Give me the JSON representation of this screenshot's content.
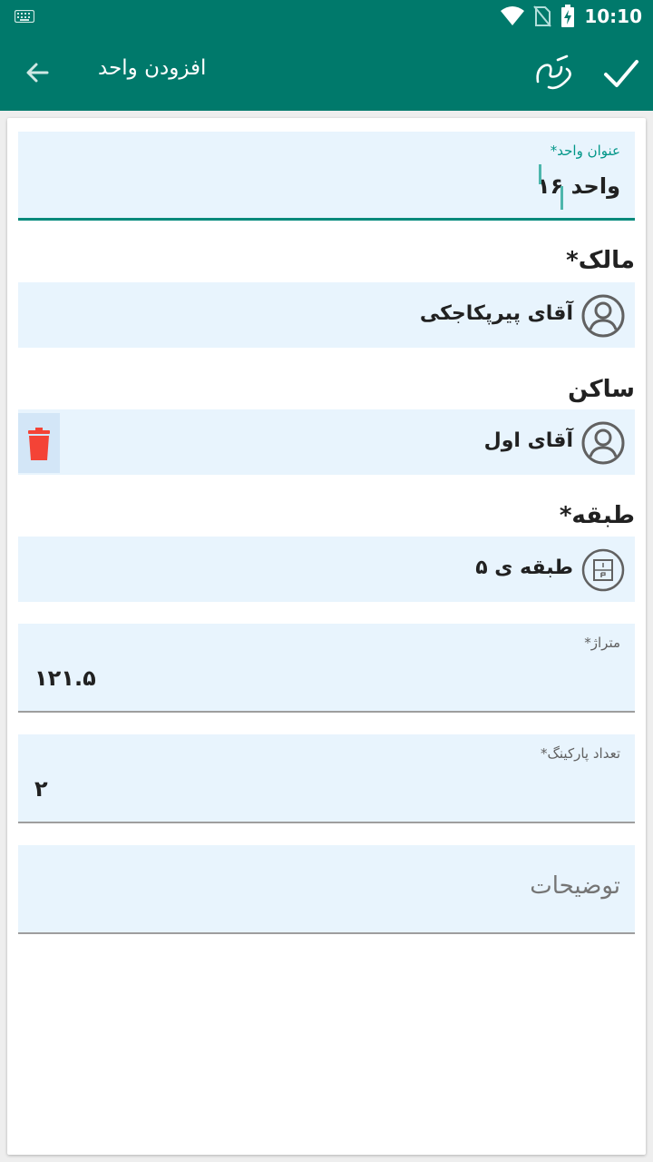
{
  "status": {
    "time": "10:10"
  },
  "toolbar": {
    "title": "افزودن واحد"
  },
  "form": {
    "unit_title": {
      "label": "عنوان واحد*",
      "value": "واحد ۱۶"
    },
    "owner": {
      "label": "مالک*",
      "name": "آقای پیرپکاجکی"
    },
    "resident": {
      "label": "ساکن",
      "name": "آقای اول"
    },
    "floor": {
      "label": "طبقه*",
      "name": "طبقه ی ۵"
    },
    "area": {
      "label": "متراژ*",
      "value": "۱۲۱.۵"
    },
    "parking": {
      "label": "تعداد پارکینگ*",
      "value": "۲"
    },
    "description": {
      "placeholder": "توضیحات"
    }
  },
  "colors": {
    "primary": "#00796b",
    "accent": "#009688",
    "field_bg": "#e8f4fd",
    "delete": "#f44336"
  }
}
